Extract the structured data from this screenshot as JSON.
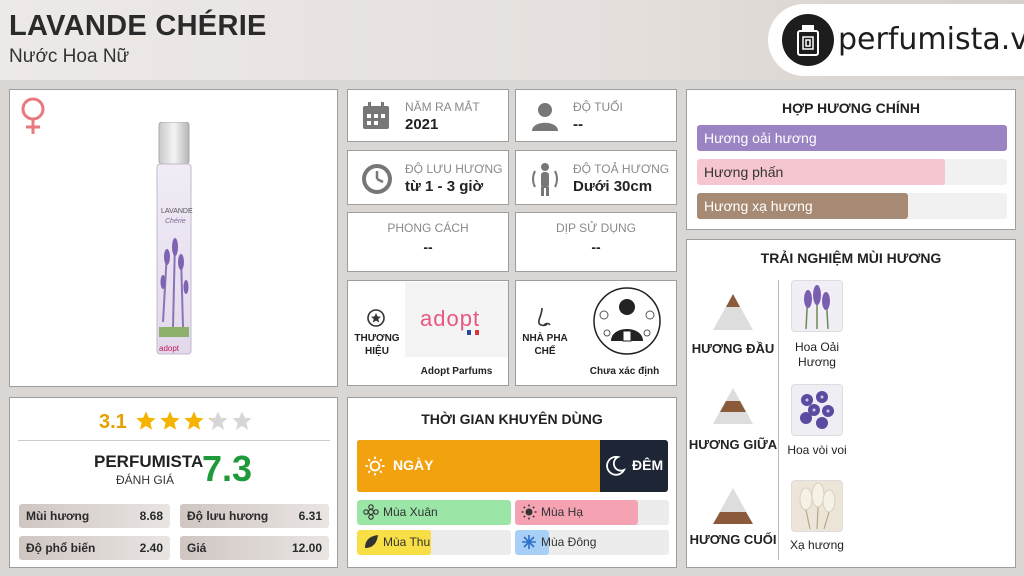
{
  "header": {
    "title": "LAVANDE CHÉRIE",
    "subtitle": "Nước Hoa Nữ",
    "logo": "perfumista.vn"
  },
  "product": {
    "gender_icon": "female-icon",
    "bottle_label": "LAVANDE",
    "bottle_sub": "Chérie",
    "bottle_brand": "adopt"
  },
  "rating": {
    "stars_value": 3.1,
    "stars_text": "3.1",
    "perfumista_label": "PERFUMISTA",
    "danh_gia_label": "ĐÁNH GIÁ",
    "score": "7.3"
  },
  "stats": [
    {
      "label": "Mùi hương",
      "value": "8.68"
    },
    {
      "label": "Độ lưu hương",
      "value": "6.31"
    },
    {
      "label": "Độ phổ biến",
      "value": "2.40"
    },
    {
      "label": "Giá",
      "value": "12.00"
    }
  ],
  "info": {
    "nam_ra_mat": {
      "label": "NĂM RA MẮT",
      "value": "2021"
    },
    "do_tuoi": {
      "label": "ĐỘ TUỔI",
      "value": "--"
    },
    "do_luu_huong": {
      "label": "ĐỘ LƯU HƯƠNG",
      "value": "từ 1 - 3 giờ"
    },
    "do_toa_huong": {
      "label": "ĐỘ TOẢ HƯƠNG",
      "value": "Dưới 30cm"
    },
    "phong_cach": {
      "label": "PHONG CÁCH",
      "value": "--"
    },
    "dip_su_dung": {
      "label": "DỊP SỬ DỤNG",
      "value": "--"
    }
  },
  "brand": {
    "label_line1": "THƯƠNG",
    "label_line2": "HIỆU",
    "logo_text": "adopt",
    "name": "Adopt Parfums"
  },
  "perfumer": {
    "label_line1": "NHÀ PHA",
    "label_line2": "CHẾ",
    "name": "Chưa xác định"
  },
  "usage_time": {
    "title": "THỜI GIAN KHUYÊN DÙNG",
    "day_label": "NGÀY",
    "night_label": "ĐÊM",
    "day_fraction": 0.78,
    "seasons": [
      {
        "label": "Mùa Xuân",
        "level": 1.0,
        "color": "#9be6a6"
      },
      {
        "label": "Mùa Hạ",
        "level": 0.8,
        "color": "#f5a3b3"
      },
      {
        "label": "Mùa Thu",
        "level": 0.48,
        "color": "#f7df45"
      },
      {
        "label": "Mùa Đông",
        "level": 0.22,
        "color": "#a8cff5"
      }
    ]
  },
  "accords": {
    "title": "HỢP HƯƠNG CHÍNH",
    "items": [
      {
        "label": "Hương oải hương",
        "level": 1.0,
        "color": "#9b84c4"
      },
      {
        "label": "Hương phấn",
        "level": 0.8,
        "color": "#f6c6d0"
      },
      {
        "label": "Hương xạ hương",
        "level": 0.68,
        "color": "#a78a73"
      }
    ]
  },
  "notes": {
    "title": "TRẢI NGHIỆM MÙI HƯƠNG",
    "top": {
      "label": "HƯƠNG ĐẦU",
      "name": "Hoa Oải Hương"
    },
    "middle": {
      "label": "HƯƠNG GIỮA",
      "name": "Hoa vòi voi"
    },
    "base": {
      "label": "HƯƠNG CUỐI",
      "name": "Xạ hương"
    }
  }
}
